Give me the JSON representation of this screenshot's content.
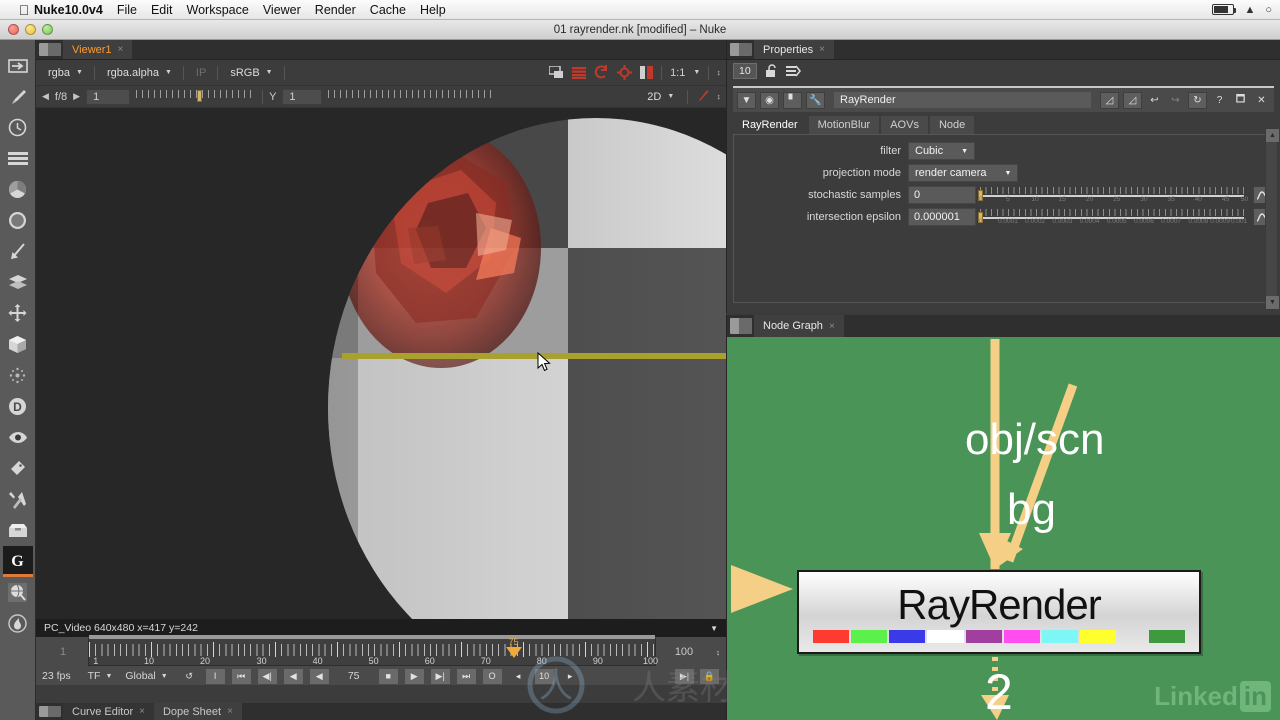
{
  "os_menu": {
    "apple_icon": "apple-icon",
    "app_name": "Nuke10.0v4",
    "items": [
      "File",
      "Edit",
      "Workspace",
      "Viewer",
      "Render",
      "Cache",
      "Help"
    ]
  },
  "window": {
    "title": "01 rayrender.nk [modified] – Nuke"
  },
  "left_toolbar": {
    "items": [
      {
        "name": "image-node-icon",
        "glyph": "image"
      },
      {
        "name": "draw-node-icon",
        "glyph": "pen"
      },
      {
        "name": "time-node-icon",
        "glyph": "clock"
      },
      {
        "name": "channel-node-icon",
        "glyph": "bars"
      },
      {
        "name": "color-node-icon",
        "glyph": "wheel"
      },
      {
        "name": "filter-node-icon",
        "glyph": "checker"
      },
      {
        "name": "keyer-node-icon",
        "glyph": "arrowdown"
      },
      {
        "name": "merge-node-icon",
        "glyph": "layers"
      },
      {
        "name": "transform-node-icon",
        "glyph": "move"
      },
      {
        "name": "3d-node-icon",
        "glyph": "cube"
      },
      {
        "name": "particles-node-icon",
        "glyph": "sparkle"
      },
      {
        "name": "deep-node-icon",
        "glyph": "dcircle"
      },
      {
        "name": "views-node-icon",
        "glyph": "eye"
      },
      {
        "name": "metadata-node-icon",
        "glyph": "tag"
      },
      {
        "name": "toolsets-node-icon",
        "glyph": "wrench"
      },
      {
        "name": "other-node-icon",
        "glyph": "box"
      },
      {
        "name": "gizmo-node-icon",
        "glyph": "G",
        "active": true
      },
      {
        "name": "nukex-node-icon",
        "glyph": "globe"
      },
      {
        "name": "furnace-node-icon",
        "glyph": "swirl"
      }
    ]
  },
  "viewer": {
    "tab_label": "Viewer1",
    "tab_close": "×",
    "channel_select": "rgba",
    "layer_select": "rgba.alpha",
    "ip_label": "IP",
    "colorspace": "sRGB",
    "gain_label": "f/8",
    "gain_value": "1",
    "gamma_label": "Y",
    "gamma_value": "1",
    "zoom_level": "1:1",
    "view_mode": "2D",
    "toolbar_icons": [
      "proxy-icon",
      "channel-strip-icon",
      "refresh-icon",
      "roi-icon",
      "pause-icon"
    ],
    "status": "PC_Video 640x480   x=417 y=242"
  },
  "timeline": {
    "frame_start": "1",
    "frame_end": "100",
    "playhead_frame": "75",
    "tick_labels": [
      "1",
      "10",
      "20",
      "30",
      "40",
      "50",
      "60",
      "70",
      "80",
      "90",
      "100"
    ],
    "fps": "23 fps",
    "time_mode": "TF",
    "sync_mode": "Global",
    "current_frame": "75",
    "increment": "10",
    "buttons": [
      "loop-icon",
      "in-point-icon",
      "first-frame-icon",
      "prev-keyframe-icon",
      "prev-frame-icon",
      "play-backward-icon",
      "stop-icon",
      "play-forward-icon",
      "next-keyframe-icon",
      "last-frame-icon",
      "out-point-icon",
      "step-back-icon",
      "step-forward-icon",
      "playback-mode-icon",
      "lock-range-icon"
    ]
  },
  "bottom_tabs": [
    {
      "label": "Curve Editor",
      "close": "×",
      "active": false
    },
    {
      "label": "Dope Sheet",
      "close": "×",
      "active": true
    }
  ],
  "properties": {
    "tab_label": "Properties",
    "tab_close": "×",
    "max_panels": "10",
    "lock_icon": "lock-open-icon",
    "clear_icon": "clear-all-icon",
    "node_name": "RayRender",
    "header_icons": [
      "dropdown-caret-icon",
      "color-wheel-icon",
      "mask-icon",
      "wrench-icon"
    ],
    "header_right_icons": [
      "disable-icon",
      "mix-icon",
      "undo-icon",
      "redo-icon",
      "revert-icon",
      "help-icon",
      "float-icon",
      "close-icon"
    ],
    "tabs": [
      {
        "label": "RayRender",
        "active": true
      },
      {
        "label": "MotionBlur",
        "active": false
      },
      {
        "label": "AOVs",
        "active": false
      },
      {
        "label": "Node",
        "active": false
      }
    ],
    "knobs": [
      {
        "label": "filter",
        "type": "combo",
        "value": "Cubic"
      },
      {
        "label": "projection mode",
        "type": "combo",
        "value": "render camera"
      },
      {
        "label": "stochastic samples",
        "type": "slider",
        "value": "0",
        "ticks": [
          "0",
          "5",
          "10",
          "15",
          "20",
          "25",
          "30",
          "35",
          "40",
          "45",
          "50"
        ]
      },
      {
        "label": "intersection epsilon",
        "type": "slider",
        "value": "0.000001",
        "ticks": [
          "0",
          "0.0001",
          "0.0002",
          "0.0003",
          "0.0004",
          "0.0005",
          "0.0006",
          "0.0007",
          "0.0008",
          "0.0009",
          "0.001"
        ]
      }
    ]
  },
  "node_graph": {
    "tab_label": "Node Graph",
    "tab_close": "×",
    "background_color": "#4a9457",
    "input_labels": [
      {
        "text": "obj/scn",
        "name": "input-label-obj-scn"
      },
      {
        "text": "bg",
        "name": "input-label-bg"
      },
      {
        "text": "2",
        "name": "output-label-2"
      }
    ],
    "node": {
      "title": "RayRender",
      "swatch_colors": [
        "#ff3b30",
        "#5cf04a",
        "#3a3ae8",
        "#ffffff",
        "#a03fa0",
        "#ff4df0",
        "#7ef6f6",
        "#ffff2e"
      ],
      "extra_swatch_color": "#3f9a3f"
    },
    "watermark": {
      "text": "Linked",
      "badge": "in"
    }
  }
}
